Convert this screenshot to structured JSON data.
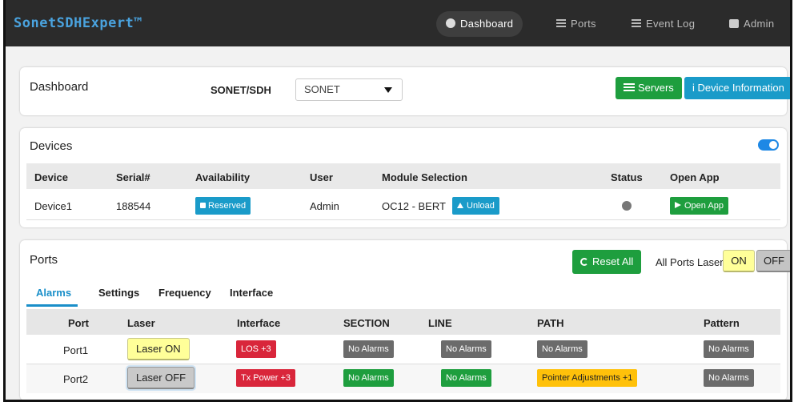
{
  "navbar": {
    "brand": "SonetSDHExpert™",
    "items": [
      {
        "label": "Dashboard",
        "icon": "dashboard-icon",
        "active": true
      },
      {
        "label": "Ports",
        "icon": "list-icon",
        "active": false
      },
      {
        "label": "Event Log",
        "icon": "list-icon",
        "active": false
      },
      {
        "label": "Admin",
        "icon": "user-icon",
        "active": false
      }
    ]
  },
  "dashboard": {
    "title": "Dashboard",
    "mode_label": "SONET/SDH",
    "mode_value": "SONET",
    "servers_label": "Servers",
    "device_info_label": "i Device Information"
  },
  "devices": {
    "title": "Devices",
    "columns": [
      "Device",
      "Serial#",
      "Availability",
      "User",
      "Module Selection",
      "Status",
      "Open App"
    ],
    "rows": [
      {
        "device": "Device1",
        "serial": "188544",
        "availability": "Reserved",
        "user": "Admin",
        "module": "OC12 - BERT",
        "unload_label": "Unload",
        "open_app_label": "Open App"
      }
    ]
  },
  "ports": {
    "title": "Ports",
    "reset_label": "Reset All",
    "all_ports_laser_label": "All Ports Laser",
    "on_label": "ON",
    "off_label": "OFF",
    "tabs": [
      "Alarms",
      "Settings",
      "Frequency",
      "Interface"
    ],
    "columns": [
      "Port",
      "Laser",
      "Interface",
      "SECTION",
      "LINE",
      "PATH",
      "Pattern"
    ],
    "rows": [
      {
        "port": "Port1",
        "laser": "Laser ON",
        "interface": "LOS +3",
        "section": "No Alarms",
        "line": "No Alarms",
        "path": "No Alarms",
        "pattern": "No Alarms"
      },
      {
        "port": "Port2",
        "laser": "Laser OFF",
        "interface": "Tx Power +3",
        "section": "No Alarms",
        "line": "No Alarms",
        "path": "Pointer Adjustments +1",
        "pattern": "No Alarms"
      }
    ]
  },
  "colors": {
    "brand": "#4aa3df",
    "green": "#1e9e3e",
    "teal": "#1a9bc9",
    "red": "#d9263b",
    "grey": "#6b6b6b",
    "yellow": "#ffc10a"
  }
}
